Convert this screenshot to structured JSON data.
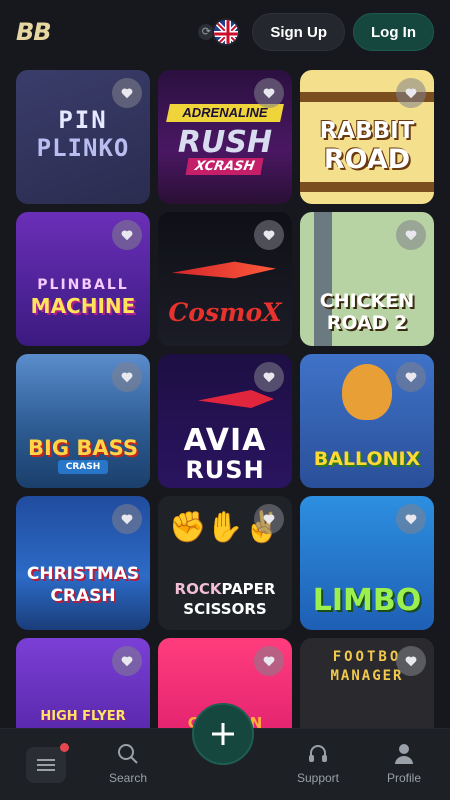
{
  "header": {
    "logo": "BB",
    "signup_label": "Sign Up",
    "login_label": "Log In",
    "language_icon": "uk-flag-icon"
  },
  "games": [
    {
      "title": "PIN",
      "sub": "PLINKO"
    },
    {
      "ribbon": "ADRENALINE",
      "title": "RUSH",
      "sub": "XCRASH"
    },
    {
      "title": "RABBIT",
      "sub": "ROAD"
    },
    {
      "title": "PLINBALL",
      "sub": "MACHINE"
    },
    {
      "title": "CosmoX"
    },
    {
      "title": "CHICKEN",
      "sub": "ROAD 2"
    },
    {
      "title": "BIG BASS",
      "sub": "CRASH"
    },
    {
      "title": "AVIA",
      "sub": "RUSH"
    },
    {
      "title": "BALLONIX"
    },
    {
      "title": "CHRISTMAS",
      "sub": "CRASH"
    },
    {
      "title_a": "ROCK",
      "title_b": "PAPER",
      "sub": "SCISSORS"
    },
    {
      "title": "LIMBO"
    },
    {
      "title": "HIGH FLYER"
    },
    {
      "title": "CHICKEN"
    },
    {
      "title": "FOOTBO",
      "sub": "MANAGER"
    }
  ],
  "bottom_nav": {
    "search_label": "Search",
    "support_label": "Support",
    "profile_label": "Profile"
  },
  "colors": {
    "background": "#16181d",
    "accent_green": "#15473e",
    "logo_gold": "#e8d6a0",
    "notification_dot": "#e5464f"
  }
}
